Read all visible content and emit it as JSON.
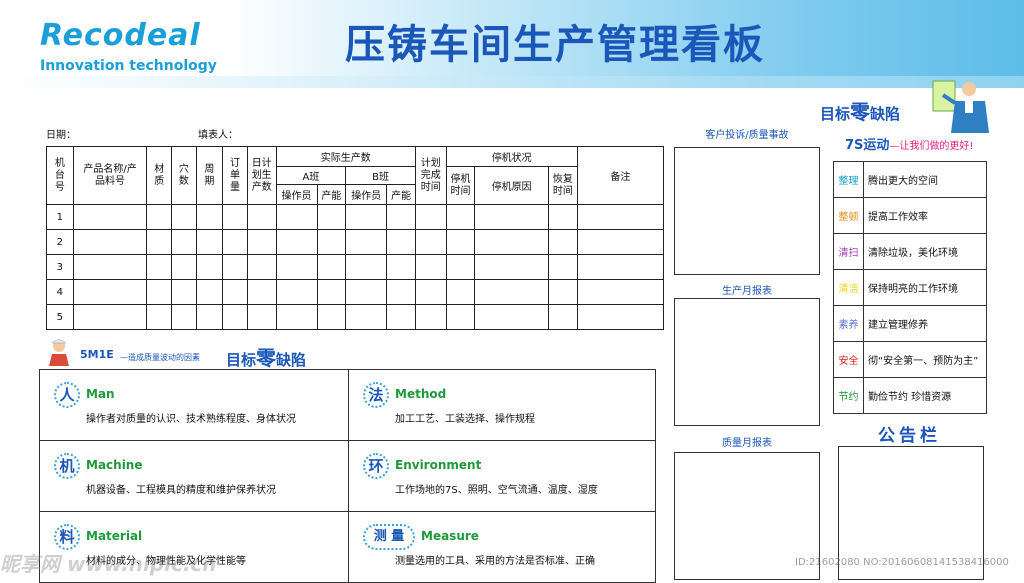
{
  "header": {
    "logo": "Recodeal",
    "logo_sub": "Innovation technology",
    "title": "压铸车间生产管理看板"
  },
  "form": {
    "date_label": "日期：",
    "filler_label": "填表人："
  },
  "table": {
    "h_machine_no": "机台号",
    "h_product": "产品名称/产品料号",
    "h_material": "材质",
    "h_cavity": "穴数",
    "h_cycle": "周期",
    "h_order": "订单量",
    "h_plan_qty": "日计划生产数",
    "h_actual": "实际生产数",
    "h_shift_a": "A班",
    "h_shift_b": "B班",
    "h_operator_a": "操作员",
    "h_output_a": "产能",
    "h_operator_b": "操作员",
    "h_output_b": "产能",
    "h_plan_time": "计划完成时间",
    "h_downtime": "停机状况",
    "h_stop_time": "停机时间",
    "h_stop_reason": "停机原因",
    "h_resume_time": "恢复时间",
    "h_remark": "备注",
    "rows": [
      "1",
      "2",
      "3",
      "4",
      "5"
    ]
  },
  "right_panels": {
    "complaint": "客户投诉/质量事故",
    "monthly_production": "生产月报表",
    "monthly_quality": "质量月报表"
  },
  "zero_defect_top": {
    "prefix": "目标",
    "big": "零",
    "suffix": "缺陷"
  },
  "s7": {
    "title": "7S运动",
    "subtitle": "—让我们做的更好!",
    "items": [
      {
        "key": "整理",
        "value": "腾出更大的空间",
        "color": "#1aa0d8"
      },
      {
        "key": "整顿",
        "value": "提高工作效率",
        "color": "#f08a1c"
      },
      {
        "key": "清扫",
        "value": "清除垃圾，美化环境",
        "color": "#9b3fb5"
      },
      {
        "key": "清洁",
        "value": "保持明亮的工作环境",
        "color": "#f2d21a"
      },
      {
        "key": "素养",
        "value": "建立管理修养",
        "color": "#5b6fd0"
      },
      {
        "key": "安全",
        "value": "彻“安全第一、预防为主”",
        "color": "#e0201c"
      },
      {
        "key": "节约",
        "value": "勤俭节约 珍惜资源",
        "color": "#1f9a3a"
      }
    ]
  },
  "notice": {
    "title": "公告栏"
  },
  "m5e": {
    "title": "5M1E",
    "note": "—造成质量波动的因素",
    "zero_prefix": "目标",
    "zero_big": "零",
    "zero_suffix": "缺陷",
    "items": [
      {
        "char": "人",
        "name": "Man",
        "desc": "操作者对质量的认识、技术熟练程度、身体状况"
      },
      {
        "char": "法",
        "name": "Method",
        "desc": "加工工艺、工装选择、操作规程"
      },
      {
        "char": "机",
        "name": "Machine",
        "desc": "机器设备、工程模具的精度和维护保养状况"
      },
      {
        "char": "环",
        "name": "Environment",
        "desc": "工作场地的7S、照明、空气流通、温度、湿度"
      },
      {
        "char": "料",
        "name": "Material",
        "desc": "材料的成分、物理性能及化学性能等"
      },
      {
        "char": "测  量",
        "name": "Measure",
        "desc": "测量选用的工具、采用的方法是否标准、正确"
      }
    ]
  },
  "watermark": {
    "left": "昵享网 www.nipic.cn",
    "right": "ID:21602080 NO:20160608141538416000"
  }
}
